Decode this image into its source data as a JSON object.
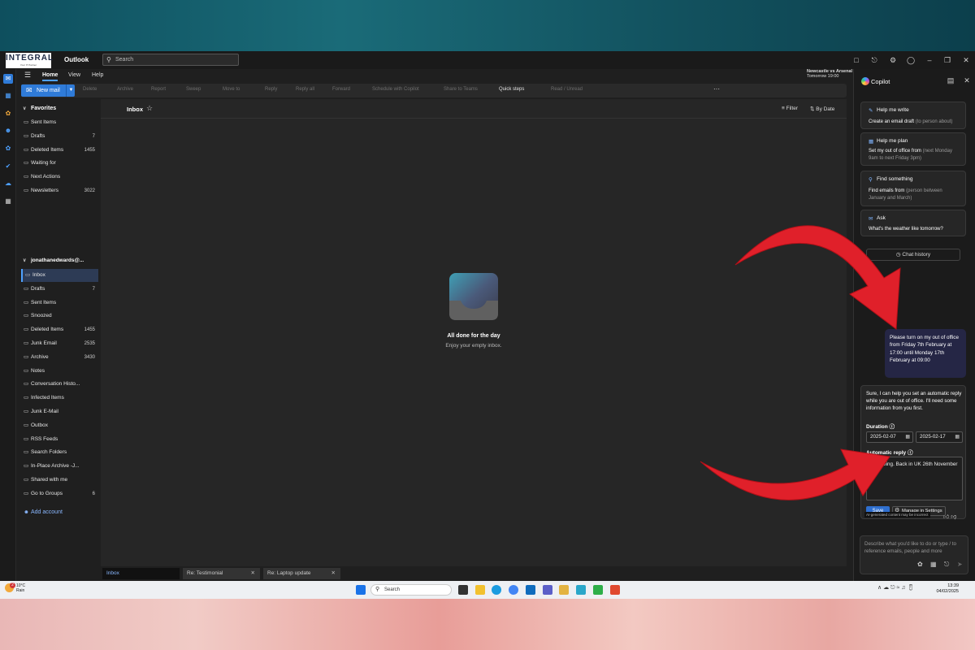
{
  "app": {
    "logo_text": "INTEGRAL",
    "logo_tagline": "Your IT Partner",
    "name": "Outlook",
    "search_placeholder": "Search"
  },
  "menu": {
    "tabs": [
      "Home",
      "View",
      "Help"
    ],
    "calendar_peek": {
      "event": "Newcastle vs Arsenal",
      "when": "Tomorrow 19:00"
    }
  },
  "ribbon": {
    "new_mail": "New mail",
    "buttons": [
      "Delete",
      "Archive",
      "Report",
      "Sweep",
      "Move to",
      "Reply",
      "Reply all",
      "Forward",
      "Schedule with Copilot",
      "Share to Teams",
      "Quick steps",
      "Read / Unread"
    ],
    "more": "···"
  },
  "folders": {
    "favorites_label": "Favorites",
    "favorites": [
      {
        "label": "Sent Items",
        "count": "",
        "icon": "send-icon"
      },
      {
        "label": "Drafts",
        "count": "7",
        "icon": "pencil-icon"
      },
      {
        "label": "Deleted Items",
        "count": "1455",
        "icon": "trash-icon"
      },
      {
        "label": "Waiting for",
        "count": "",
        "icon": "tag-icon"
      },
      {
        "label": "Next Actions",
        "count": "",
        "icon": "tag-icon"
      },
      {
        "label": "Newsletters",
        "count": "3022",
        "icon": "tag-icon"
      }
    ],
    "account_label": "jonathanedwards@...",
    "account": [
      {
        "label": "Inbox",
        "count": ""
      },
      {
        "label": "Drafts",
        "count": "7"
      },
      {
        "label": "Sent Items",
        "count": ""
      },
      {
        "label": "Snoozed",
        "count": ""
      },
      {
        "label": "Deleted Items",
        "count": "1455"
      },
      {
        "label": "Junk Email",
        "count": "2535"
      },
      {
        "label": "Archive",
        "count": "3430"
      },
      {
        "label": "Notes",
        "count": ""
      },
      {
        "label": "Conversation Histo...",
        "count": ""
      },
      {
        "label": "Infected Items",
        "count": ""
      },
      {
        "label": "Junk E-Mail",
        "count": ""
      },
      {
        "label": "Outbox",
        "count": ""
      },
      {
        "label": "RSS Feeds",
        "count": ""
      },
      {
        "label": "Search Folders",
        "count": ""
      },
      {
        "label": "In-Place Archive -J...",
        "count": ""
      },
      {
        "label": "Shared with me",
        "count": ""
      },
      {
        "label": "Go to Groups",
        "count": "6"
      }
    ],
    "add_account": "Add account"
  },
  "message_list": {
    "title": "Inbox",
    "filter": "Filter",
    "sort": "By Date",
    "empty_title": "All done for the day",
    "empty_subtitle": "Enjoy your empty inbox."
  },
  "bottom_tabs": [
    "Inbox",
    "Re: Testimonial",
    "Re: Laptop update"
  ],
  "copilot": {
    "title": "Copilot",
    "cards": [
      {
        "title": "Help me write",
        "desc": "Create an email draft",
        "hint": "(to person about)"
      },
      {
        "title": "Help me plan",
        "desc": "Set my out of office from",
        "hint": "(next Monday 9am to next Friday 3pm)"
      },
      {
        "title": "Find something",
        "desc": "Find emails from",
        "hint": "(person between January and March)"
      },
      {
        "title": "Ask",
        "desc": "What's the weather like tomorrow?",
        "hint": ""
      }
    ],
    "chat_history": "Chat history",
    "user_message": "Please turn on my out of office from Friday 7th February at 17:00 until Monday 17th February at 09:00",
    "ai_message": "Sure, I can help you set an automatic reply while you are out of office. I'll need some information from you first.",
    "duration_label": "Duration",
    "start_date": "2025-02-07",
    "end_date": "2025-02-17",
    "auto_reply_label": "Automatic reply",
    "auto_reply_text": "Travelling. Back in UK 26th November",
    "save": "Save",
    "manage": "Manage in Settings",
    "disclaimer": "AI-generated content may be incorrect",
    "prompt_placeholder": "Describe what you'd like to do or type / to reference emails, people and more"
  },
  "taskbar": {
    "weather_temp": "10°C",
    "weather_desc": "Rain",
    "weather_badge": "2",
    "search_placeholder": "Search",
    "time": "13:39",
    "date": "04/02/2025"
  },
  "colors": {
    "accent": "#2f7bd8",
    "arrow": "#e0202a",
    "user_bubble": "#252645"
  }
}
